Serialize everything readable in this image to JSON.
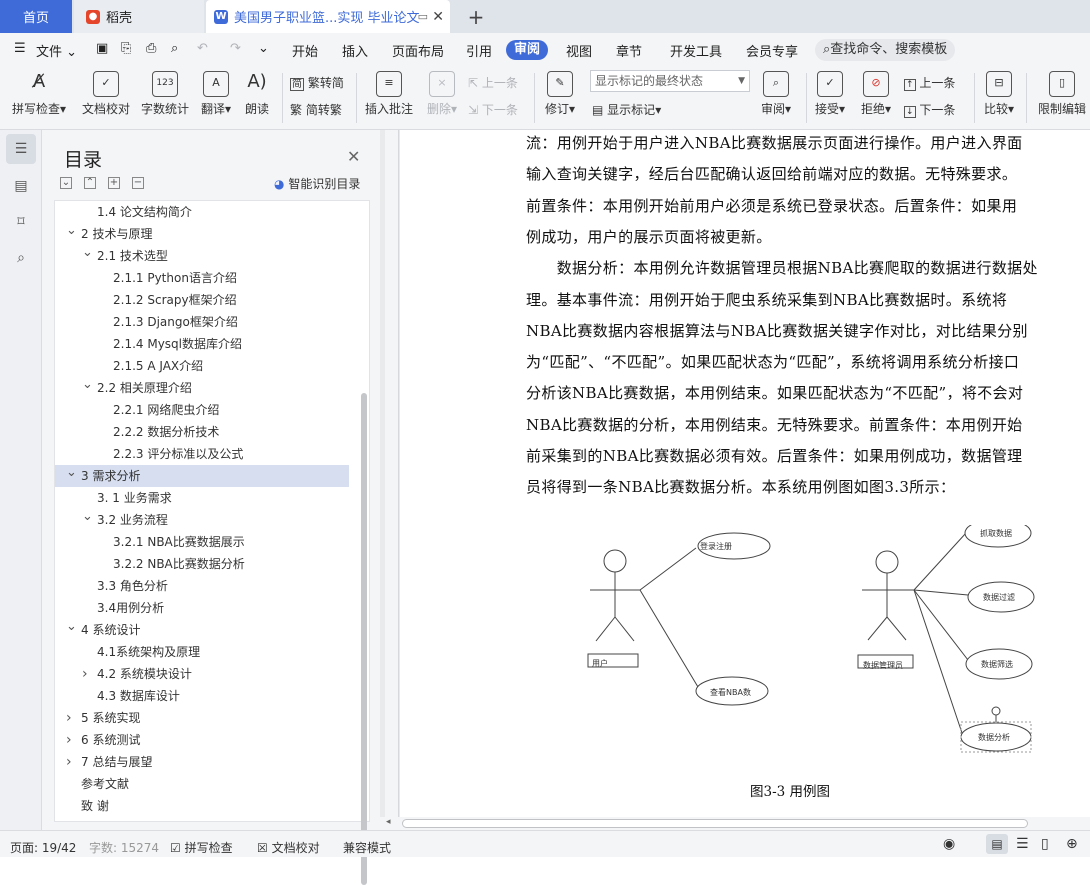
{
  "tabs": {
    "home": "首页",
    "daoke": "稻壳",
    "doc": "美国男子职业篮...实现 毕业论文"
  },
  "menu": {
    "file": "文件",
    "items": [
      "开始",
      "插入",
      "页面布局",
      "引用",
      "审阅",
      "视图",
      "章节",
      "开发工具",
      "会员专享"
    ],
    "search": "查找命令、搜索模板"
  },
  "ribbon": {
    "spell": "拼写检查",
    "proof": "文档校对",
    "wordcount": "字数统计",
    "translate": "翻译",
    "read": "朗读",
    "t2s": "繁转简",
    "s2t": "简转繁",
    "insert_comment": "插入批注",
    "delete": "删除",
    "prev_comment": "上一条",
    "next_comment": "下一条",
    "revise": "修订",
    "markup_mode": "显示标记的最终状态",
    "show_markup": "显示标记",
    "review": "审阅",
    "accept": "接受",
    "reject": "拒绝",
    "prev": "上一条",
    "next": "下一条",
    "compare": "比较",
    "restrict": "限制编辑"
  },
  "toc": {
    "title": "目录",
    "smart": "智能识别目录",
    "items": [
      {
        "text": "1.4 论文结构简介",
        "level": 2,
        "arrow": ""
      },
      {
        "text": "2 技术与原理",
        "level": 1,
        "arrow": "down"
      },
      {
        "text": "2.1 技术选型",
        "level": 2,
        "arrow": "down"
      },
      {
        "text": "2.1.1 Python语言介绍",
        "level": 3,
        "arrow": ""
      },
      {
        "text": "2.1.2 Scrapy框架介绍",
        "level": 3,
        "arrow": ""
      },
      {
        "text": "2.1.3 Django框架介绍",
        "level": 3,
        "arrow": ""
      },
      {
        "text": "2.1.4 Mysql数据库介绍",
        "level": 3,
        "arrow": ""
      },
      {
        "text": "2.1.5 A JAX介绍",
        "level": 3,
        "arrow": ""
      },
      {
        "text": "2.2 相关原理介绍",
        "level": 2,
        "arrow": "down"
      },
      {
        "text": "2.2.1 网络爬虫介绍",
        "level": 3,
        "arrow": ""
      },
      {
        "text": "2.2.2 数据分析技术",
        "level": 3,
        "arrow": ""
      },
      {
        "text": "2.2.3 评分标准以及公式",
        "level": 3,
        "arrow": ""
      },
      {
        "text": "3 需求分析",
        "level": 1,
        "arrow": "down",
        "selected": true
      },
      {
        "text": "3. 1 业务需求",
        "level": 2,
        "arrow": ""
      },
      {
        "text": "3.2 业务流程",
        "level": 2,
        "arrow": "down"
      },
      {
        "text": "3.2.1 NBA比赛数据展示",
        "level": 3,
        "arrow": ""
      },
      {
        "text": "3.2.2 NBA比赛数据分析",
        "level": 3,
        "arrow": ""
      },
      {
        "text": "3.3 角色分析",
        "level": 2,
        "arrow": ""
      },
      {
        "text": "3.4用例分析",
        "level": 2,
        "arrow": ""
      },
      {
        "text": "4 系统设计",
        "level": 1,
        "arrow": "down"
      },
      {
        "text": "4.1系统架构及原理",
        "level": 2,
        "arrow": ""
      },
      {
        "text": "4.2 系统模块设计",
        "level": 2,
        "arrow": "right"
      },
      {
        "text": "4.3  数据库设计",
        "level": 2,
        "arrow": ""
      },
      {
        "text": "5 系统实现",
        "level": 1,
        "arrow": "right"
      },
      {
        "text": "6 系统测试",
        "level": 1,
        "arrow": "right"
      },
      {
        "text": "7 总结与展望",
        "level": 1,
        "arrow": "right"
      },
      {
        "text": "参考文献",
        "level": 1,
        "arrow": ""
      },
      {
        "text": "致  谢",
        "level": 1,
        "arrow": ""
      }
    ]
  },
  "doc": {
    "lines": [
      "流：用例开始于用户进入NBA比赛数据展示页面进行操作。用户进入界面",
      "输入查询关键字，经后台匹配确认返回给前端对应的数据。无特殊要求。",
      "前置条件：本用例开始前用户必须是系统已登录状态。后置条件：如果用",
      "例成功，用户的展示页面将被更新。",
      "　　数据分析：本用例允许数据管理员根据NBA比赛爬取的数据进行数据处",
      "理。基本事件流：用例开始于爬虫系统采集到NBA比赛数据时。系统将",
      "NBA比赛数据内容根据算法与NBA比赛数据关键字作对比，对比结果分别",
      "为“匹配”、“不匹配”。如果匹配状态为“匹配”，系统将调用系统分析接口",
      "分析该NBA比赛数据，本用例结束。如果匹配状态为“不匹配”，将不会对",
      "NBA比赛数据的分析，本用例结束。无特殊要求。前置条件：本用例开始",
      "前采集到的NBA比赛数据必须有效。后置条件：如果用例成功，数据管理",
      "员将得到一条NBA比赛数据分析。本系统用例图如图3.3所示："
    ],
    "caption": "图3-3 用例图",
    "uml": {
      "user": "用户",
      "login": "登录注册",
      "view": "查看NBA数",
      "admin": "数据管理员",
      "crawl": "抓取数据",
      "filter": "数据过滤",
      "select": "数据筛选",
      "analyze": "数据分析"
    }
  },
  "status": {
    "page": "页面: 19/42",
    "words": "字数: 15274",
    "spell": "拼写检查",
    "proof": "文档校对",
    "compat": "兼容模式"
  }
}
